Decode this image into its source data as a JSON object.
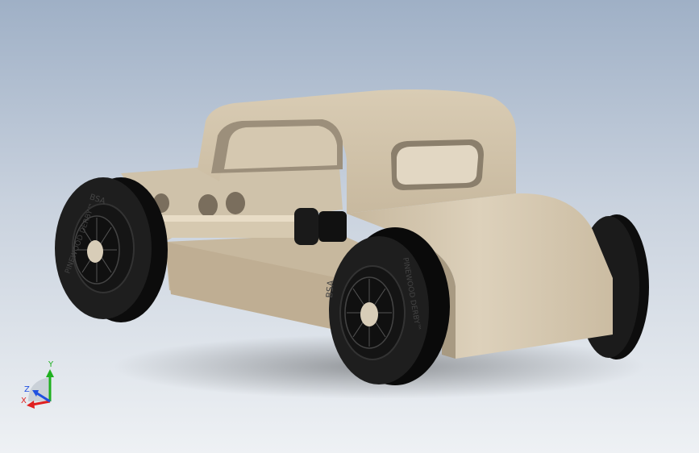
{
  "viewport": {
    "background_top": "#9fb0c6",
    "background_bottom": "#eef1f4"
  },
  "model": {
    "body_color": "#d4c7b0",
    "tire_color": "#151515",
    "axle_color": "#d9ccb5"
  },
  "wheels": {
    "front_left": {
      "top_text": "BSA",
      "side_text": "PINEWOOD DERBY™"
    },
    "front_right": {
      "top_text": "BSA",
      "side_text": "PINEWOOD DERBY™"
    }
  },
  "triad": {
    "x_label": "X",
    "y_label": "Y",
    "z_label": "Z",
    "x_color": "#e02020",
    "y_color": "#20b020",
    "z_color": "#2050e0"
  }
}
